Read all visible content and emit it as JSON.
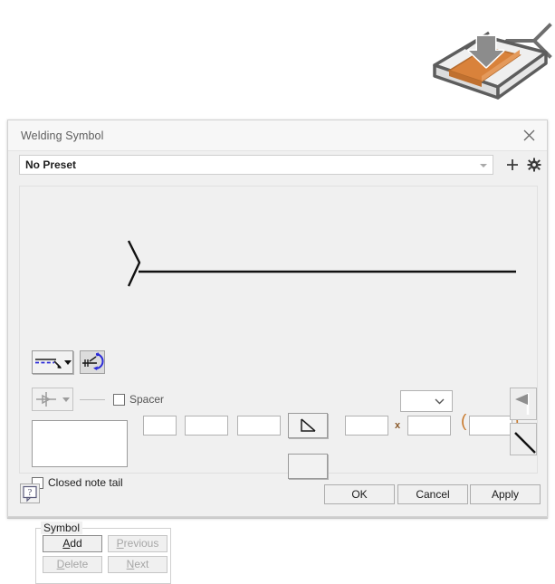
{
  "graphic": {
    "name": "weld-groove-3d-preview",
    "colors": {
      "plate": "#e9e9e9",
      "weld": "#d9823b",
      "outline": "#5d5d5d",
      "arrow": "#7a7a7a"
    }
  },
  "dialog": {
    "title": "Welding Symbol",
    "close_icon": "close-icon"
  },
  "preset": {
    "value": "No Preset",
    "placeholder": "No Preset",
    "add_icon": "plus-icon",
    "settings_icon": "gear-icon",
    "dropdown_icon": "chevron-down-icon"
  },
  "toolbar": {
    "leader_style": {
      "name": "leader-line-style",
      "icon": "dashed-leader-line-icon",
      "has_dropdown": true,
      "state": "enabled"
    },
    "flip_sides": {
      "name": "flip-weld-sides",
      "icon": "flip-arrow-icon",
      "state": "pressed"
    },
    "weld_all_around": {
      "name": "weld-all-around-style",
      "icon": "all-around-circle-icon",
      "has_dropdown": true,
      "state": "disabled"
    },
    "spacer": {
      "label": "Spacer",
      "checked": false
    }
  },
  "symbol": {
    "note_tail_field": {
      "name": "note-tail-text",
      "value": ""
    },
    "closed_note_tail": {
      "label": "Closed note tail",
      "checked": false
    },
    "arrow_side": {
      "prefix_field": {
        "value": ""
      },
      "size_field": {
        "value": ""
      },
      "length_field": {
        "value": ""
      },
      "contour_button": {
        "icon": "contour-flush-icon"
      }
    },
    "other_side": {
      "symbol_button": {
        "icon": "blank-weld-symbol-icon"
      }
    },
    "process_combo": {
      "value": "",
      "icon": "chevron-down-icon"
    },
    "pitch": {
      "count_field": {
        "value": ""
      },
      "separator": "x",
      "spacing_field": {
        "value": ""
      },
      "paren_open": "(",
      "paren_close": ")",
      "paren_field": {
        "value": ""
      }
    },
    "tail_buttons": {
      "field_weld": {
        "icon": "field-weld-flag-icon"
      },
      "tail": {
        "icon": "tail-line-icon"
      }
    }
  },
  "symbol_group": {
    "legend": "Symbol",
    "buttons": [
      {
        "name": "add-symbol-button",
        "label": "Add",
        "accel": "A",
        "enabled": true
      },
      {
        "name": "previous-symbol-button",
        "label": "Previous",
        "accel": "P",
        "enabled": false
      },
      {
        "name": "delete-symbol-button",
        "label": "Delete",
        "accel": "D",
        "enabled": false
      },
      {
        "name": "next-symbol-button",
        "label": "Next",
        "accel": "N",
        "enabled": false
      }
    ]
  },
  "footer": {
    "help_icon": "help-question-icon",
    "ok": "OK",
    "cancel": "Cancel",
    "apply": "Apply"
  }
}
